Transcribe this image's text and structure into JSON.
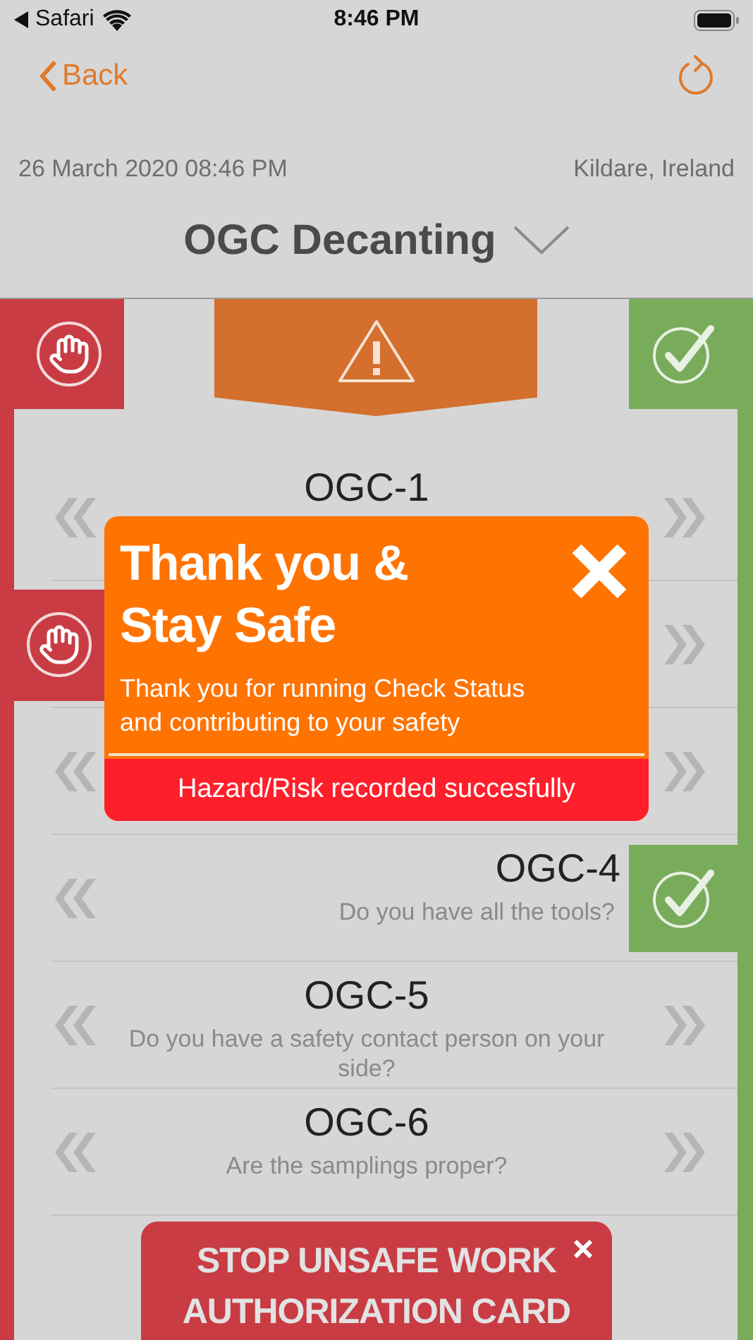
{
  "status_bar": {
    "app": "Safari",
    "time": "8:46 PM"
  },
  "nav": {
    "back": "Back"
  },
  "meta": {
    "date": "26 March 2020 08:46 PM",
    "location": "Kildare, Ireland"
  },
  "title": "OGC Decanting",
  "checks": [
    {
      "code": "OGC-1",
      "unsafe": false,
      "safe": false
    },
    {
      "unsafe": true,
      "safe": false
    },
    {
      "unsafe": false,
      "safe": false
    },
    {
      "code": "OGC-4",
      "question": "Do you have all the tools?",
      "unsafe": false,
      "safe": true
    },
    {
      "code": "OGC-5",
      "question": "Do you have a safety contact person on your side?",
      "unsafe": false,
      "safe": false
    },
    {
      "code": "OGC-6",
      "question": "Are the samplings proper?",
      "unsafe": false,
      "safe": false
    }
  ],
  "modal": {
    "title": "Thank you & Stay Safe",
    "message": "Thank you for running Check Status and contributing to your safety",
    "result": "Hazard/Risk recorded succesfully"
  },
  "stop_card": {
    "text": "STOP UNSAFE WORK AUTHORIZATION CARD"
  }
}
